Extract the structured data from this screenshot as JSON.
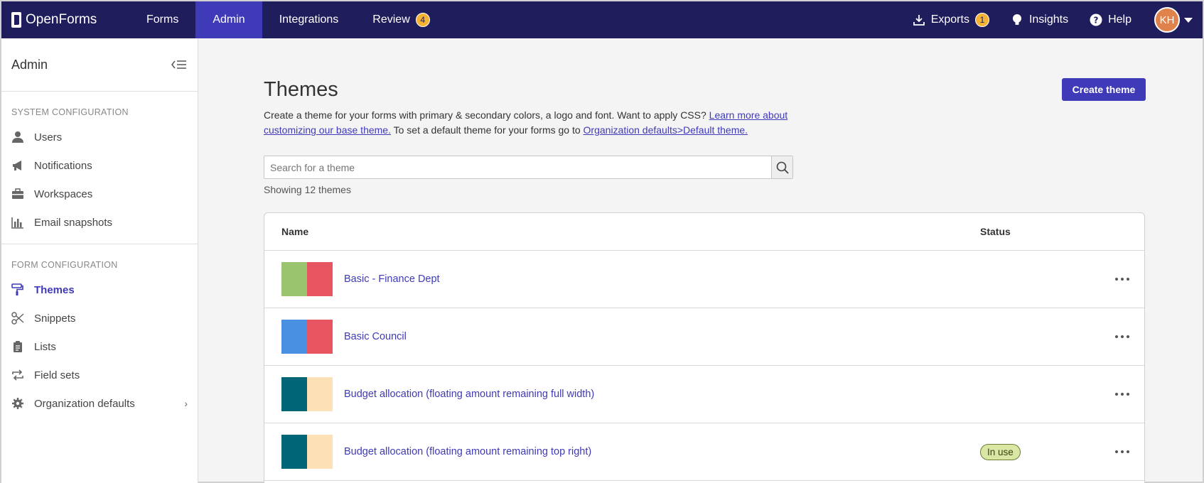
{
  "topnav": {
    "brand": "OpenForms",
    "links": [
      {
        "label": "Forms"
      },
      {
        "label": "Admin"
      },
      {
        "label": "Integrations"
      },
      {
        "label": "Review",
        "badge": "4"
      }
    ],
    "right": {
      "exports_label": "Exports",
      "exports_badge": "1",
      "insights_label": "Insights",
      "help_label": "Help",
      "avatar_initials": "KH"
    }
  },
  "sidebar": {
    "title": "Admin",
    "system_title": "SYSTEM CONFIGURATION",
    "system_items": [
      {
        "label": "Users",
        "icon": "user-icon"
      },
      {
        "label": "Notifications",
        "icon": "megaphone-icon"
      },
      {
        "label": "Workspaces",
        "icon": "briefcase-icon"
      },
      {
        "label": "Email snapshots",
        "icon": "bar-chart-icon"
      }
    ],
    "form_title": "FORM CONFIGURATION",
    "form_items": [
      {
        "label": "Themes",
        "icon": "paint-roller-icon",
        "active": true
      },
      {
        "label": "Snippets",
        "icon": "scissors-icon"
      },
      {
        "label": "Lists",
        "icon": "clipboard-icon"
      },
      {
        "label": "Field sets",
        "icon": "repeat-icon"
      },
      {
        "label": "Organization defaults",
        "icon": "gear-icon"
      }
    ]
  },
  "main": {
    "title": "Themes",
    "create_button": "Create theme",
    "description_1": "Create a theme for your forms with primary & secondary colors, a logo and font. Want to apply CSS? ",
    "description_link_1": "Learn more about customizing our base theme.",
    "description_2": " To set a default theme for your forms go to ",
    "description_link_2": "Organization defaults>Default theme.",
    "search_placeholder": "Search for a theme",
    "showing": "Showing 12 themes",
    "table": {
      "col_name": "Name",
      "col_status": "Status",
      "rows": [
        {
          "name": "Basic - Finance Dept",
          "primary": "#9bc46f",
          "secondary": "#e65560",
          "status": ""
        },
        {
          "name": "Basic Council",
          "primary": "#4a90e2",
          "secondary": "#e65560",
          "status": ""
        },
        {
          "name": "Budget allocation (floating amount remaining full width)",
          "primary": "#006677",
          "secondary": "#fde0b5",
          "status": ""
        },
        {
          "name": "Budget allocation (floating amount remaining top right)",
          "primary": "#006677",
          "secondary": "#fde0b5",
          "status": "In use"
        }
      ]
    }
  },
  "colors": {
    "nav_bg": "#1f1d5c",
    "accent": "#3e3ab8",
    "badge": "#f5b335"
  }
}
